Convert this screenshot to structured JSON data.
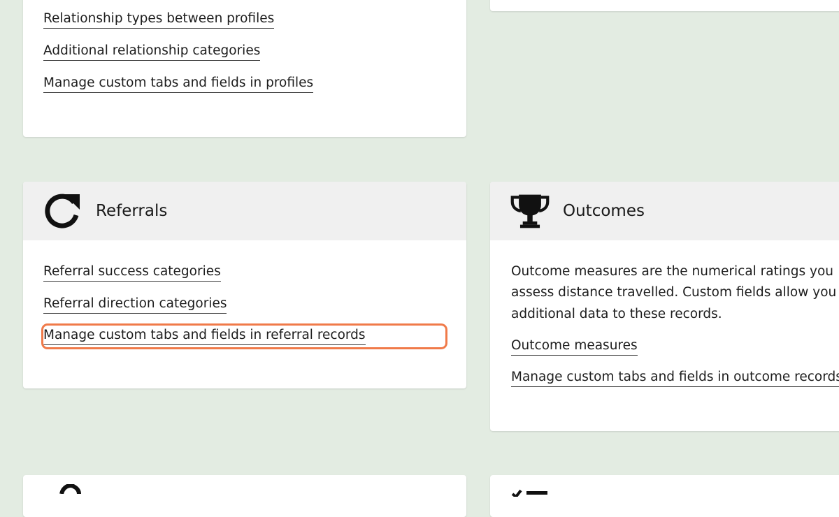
{
  "profiles_card": {
    "links": [
      "Relationship types between profiles",
      "Additional relationship categories",
      "Manage custom tabs and fields in profiles"
    ]
  },
  "referrals_card": {
    "title": "Referrals",
    "icon": "refresh-arrow-icon",
    "links": [
      "Referral success categories",
      "Referral direction categories",
      "Manage custom tabs and fields in referral records"
    ],
    "highlighted_link_index": 2
  },
  "outcomes_card": {
    "title": "Outcomes",
    "icon": "trophy-icon",
    "description": [
      "Outcome measures are the numerical ratings you",
      "assess distance travelled. Custom fields allow you",
      "additional data to these records."
    ],
    "links": [
      "Outcome measures",
      "Manage custom tabs and fields in outcome records"
    ]
  },
  "colors": {
    "page_background": "#e3ece2",
    "card_background": "#ffffff",
    "card_header_background": "#f0f0f0",
    "highlight": "#f07a49"
  }
}
